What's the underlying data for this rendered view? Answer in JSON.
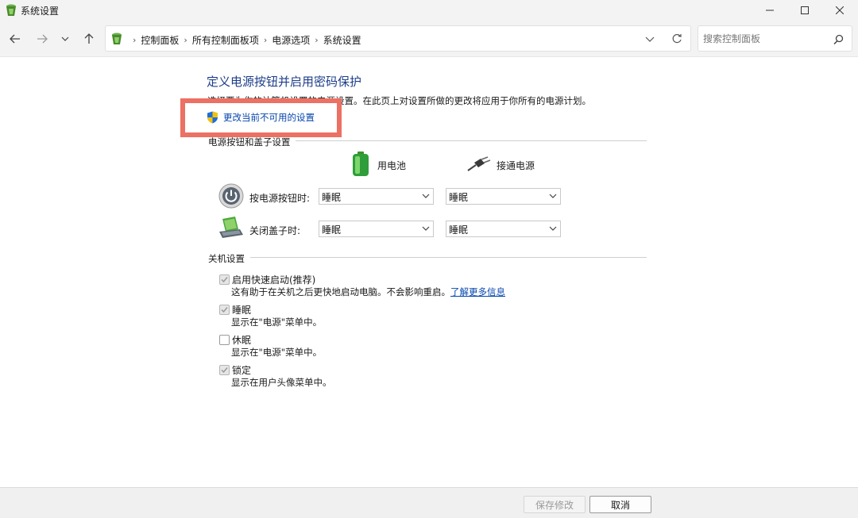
{
  "window": {
    "title": "系统设置"
  },
  "address": {
    "crumbs": [
      "控制面板",
      "所有控制面板项",
      "电源选项",
      "系统设置"
    ]
  },
  "search": {
    "placeholder": "搜索控制面板"
  },
  "page": {
    "heading": "定义电源按钮并启用密码保护",
    "subtitle": "选择要为你的计算机设置的电源设置。在此页上对设置所做的更改将应用于你所有的电源计划。",
    "change_link": "更改当前不可用的设置"
  },
  "power_section": {
    "header": "电源按钮和盖子设置",
    "columns": {
      "battery": "用电池",
      "plugged": "接通电源"
    },
    "rows": [
      {
        "label": "按电源按钮时:",
        "battery": "睡眠",
        "plugged": "睡眠"
      },
      {
        "label": "关闭盖子时:",
        "battery": "睡眠",
        "plugged": "睡眠"
      }
    ]
  },
  "shutdown_section": {
    "header": "关机设置",
    "items": [
      {
        "label": "启用快速启动(推荐)",
        "desc": "这有助于在关机之后更快地启动电脑。不会影响重启。",
        "link": "了解更多信息",
        "checked": true,
        "disabled": true
      },
      {
        "label": "睡眠",
        "desc": "显示在\"电源\"菜单中。",
        "checked": true,
        "disabled": true
      },
      {
        "label": "休眠",
        "desc": "显示在\"电源\"菜单中。",
        "checked": false,
        "disabled": false
      },
      {
        "label": "锁定",
        "desc": "显示在用户头像菜单中。",
        "checked": true,
        "disabled": true
      }
    ]
  },
  "footer": {
    "save_label": "保存修改",
    "cancel_label": "取消"
  },
  "colors": {
    "heading": "#1e3e8a",
    "link": "#0645ad",
    "highlight": "#ec7063"
  }
}
